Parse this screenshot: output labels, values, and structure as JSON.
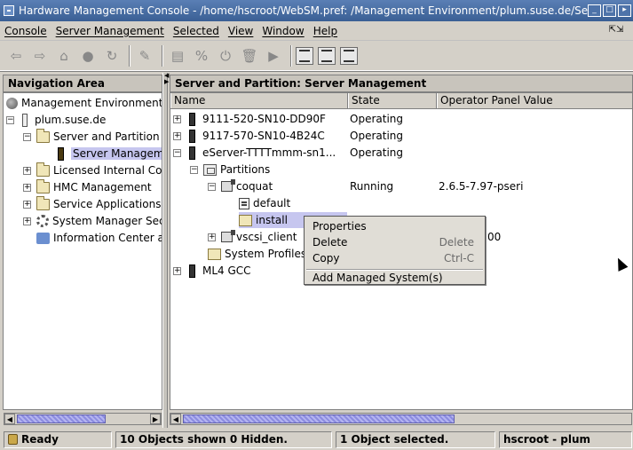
{
  "window": {
    "title": "Hardware Management Console - /home/hscroot/WebSM.pref: /Management Environment/plum.suse.de/Server and"
  },
  "menubar": {
    "items": [
      "Console",
      "Server Management",
      "Selected",
      "View",
      "Window",
      "Help"
    ]
  },
  "toolbar": {
    "icons": [
      "back-icon",
      "forward-icon",
      "up-folder-icon",
      "stop-icon",
      "refresh-icon",
      "find-icon",
      "properties-icon",
      "percent-icon",
      "power-icon",
      "delete-icon",
      "run-icon",
      "large-icons-view-icon",
      "details-view-icon",
      "tree-view-icon"
    ]
  },
  "nav": {
    "header": "Navigation Area",
    "items": [
      {
        "label": "Management Environment"
      },
      {
        "label": "plum.suse.de"
      },
      {
        "label": "Server and Partition"
      },
      {
        "label": "Server Managem"
      },
      {
        "label": "Licensed Internal Co"
      },
      {
        "label": "HMC Management"
      },
      {
        "label": "Service Applications"
      },
      {
        "label": "System Manager Sec"
      },
      {
        "label": "Information Center a"
      }
    ]
  },
  "main": {
    "header": "Server and Partition: Server Management",
    "columns": [
      "Name",
      "State",
      "Operator Panel Value"
    ],
    "rows": [
      {
        "name": "9111-520-SN10-DD90F",
        "state": "Operating",
        "panel": ""
      },
      {
        "name": "9117-570-SN10-4B24C",
        "state": "Operating",
        "panel": ""
      },
      {
        "name": "eServer-TTTTmmm-sn1...",
        "state": "Operating",
        "panel": ""
      },
      {
        "name": "Partitions",
        "state": "",
        "panel": ""
      },
      {
        "name": "coquat",
        "state": "Running",
        "panel": "2.6.5-7.97-pseri"
      },
      {
        "name": "default",
        "state": "",
        "panel": ""
      },
      {
        "name": "install",
        "state": "",
        "panel": ""
      },
      {
        "name": "vscsi_client",
        "state": "",
        "panel": "00"
      },
      {
        "name": "System Profiles",
        "state": "",
        "panel": ""
      },
      {
        "name": "ML4 GCC",
        "state": "",
        "panel": ""
      }
    ]
  },
  "context_menu": {
    "items": [
      {
        "label": "Properties",
        "shortcut": ""
      },
      {
        "label": "Delete",
        "shortcut": "Delete"
      },
      {
        "label": "Copy",
        "shortcut": "Ctrl-C"
      },
      {
        "label": "Add Managed System(s)",
        "shortcut": ""
      }
    ]
  },
  "status": {
    "ready": "Ready",
    "objects": "10 Objects shown 0 Hidden.",
    "selected": "1 Object selected.",
    "user": "hscroot - plum"
  }
}
